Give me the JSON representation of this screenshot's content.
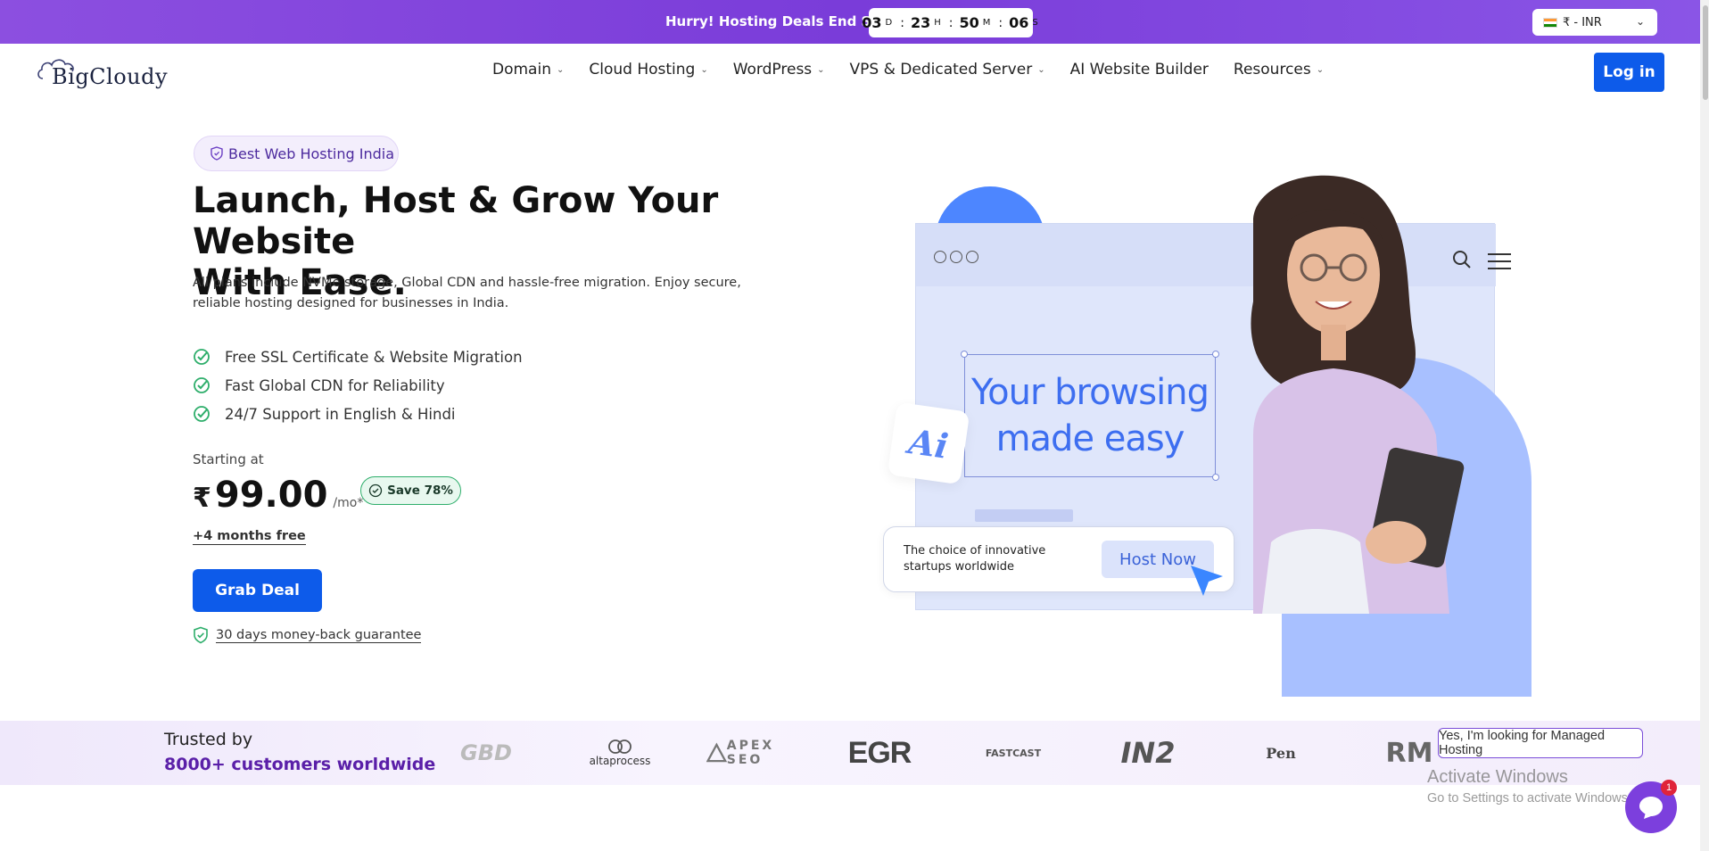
{
  "promo": {
    "text": "Hurry! Hosting Deals End Soon :",
    "countdown": {
      "days": "03",
      "days_unit": "D",
      "hours": "23",
      "hours_unit": "H",
      "minutes": "50",
      "minutes_unit": "M",
      "seconds": "06",
      "seconds_unit": "S"
    },
    "currency": "₹ - INR"
  },
  "header": {
    "logo": "BigCloudy",
    "nav": [
      {
        "label": "Domain",
        "has_dropdown": true
      },
      {
        "label": "Cloud Hosting",
        "has_dropdown": true
      },
      {
        "label": "WordPress",
        "has_dropdown": true
      },
      {
        "label": "VPS & Dedicated Server",
        "has_dropdown": true
      },
      {
        "label": "AI Website Builder",
        "has_dropdown": false
      },
      {
        "label": "Resources",
        "has_dropdown": true
      }
    ],
    "login_label": "Log in"
  },
  "hero": {
    "badge": "Best Web Hosting India",
    "headline_line1": "Launch, Host & Grow Your Website",
    "headline_line2": "With Ease.",
    "subcopy": "All plans include NVMe storage, Global CDN and hassle-free migration. Enjoy secure, reliable hosting designed for businesses in India.",
    "features": [
      "Free SSL Certificate & Website Migration",
      "Fast Global CDN for Reliability",
      "24/7 Support in English & Hindi"
    ],
    "starting_label": "Starting at",
    "currency_symbol": "₹",
    "price": "99.00",
    "per": "/mo*",
    "save_badge": "Save 78%",
    "free_months": "+4 months free",
    "cta": "Grab Deal",
    "guarantee": "30 days money-back guarantee"
  },
  "illustration": {
    "browsing_line1": "Your browsing",
    "browsing_line2": "made easy",
    "ai_label": "Ai",
    "card_text": "The choice of innovative startups worldwide",
    "card_button": "Host Now"
  },
  "trusted": {
    "title": "Trusted by",
    "subtitle": "8000+ customers worldwide",
    "logos": [
      "GBD",
      "altaprocess",
      "APEX SEO",
      "EGR",
      "FASTCAST",
      "IN2",
      "Pen",
      "RM"
    ]
  },
  "chat": {
    "prompt": "Yes, I'm looking for Managed Hosting",
    "unread": "1"
  },
  "watermark": {
    "line1": "Activate Windows",
    "line2": "Go to Settings to activate Windows."
  },
  "colors": {
    "promo_bg": "#8c4fe0",
    "primary": "#0d5bea",
    "accent_purple": "#5a1fa8",
    "success": "#2eae6b"
  }
}
